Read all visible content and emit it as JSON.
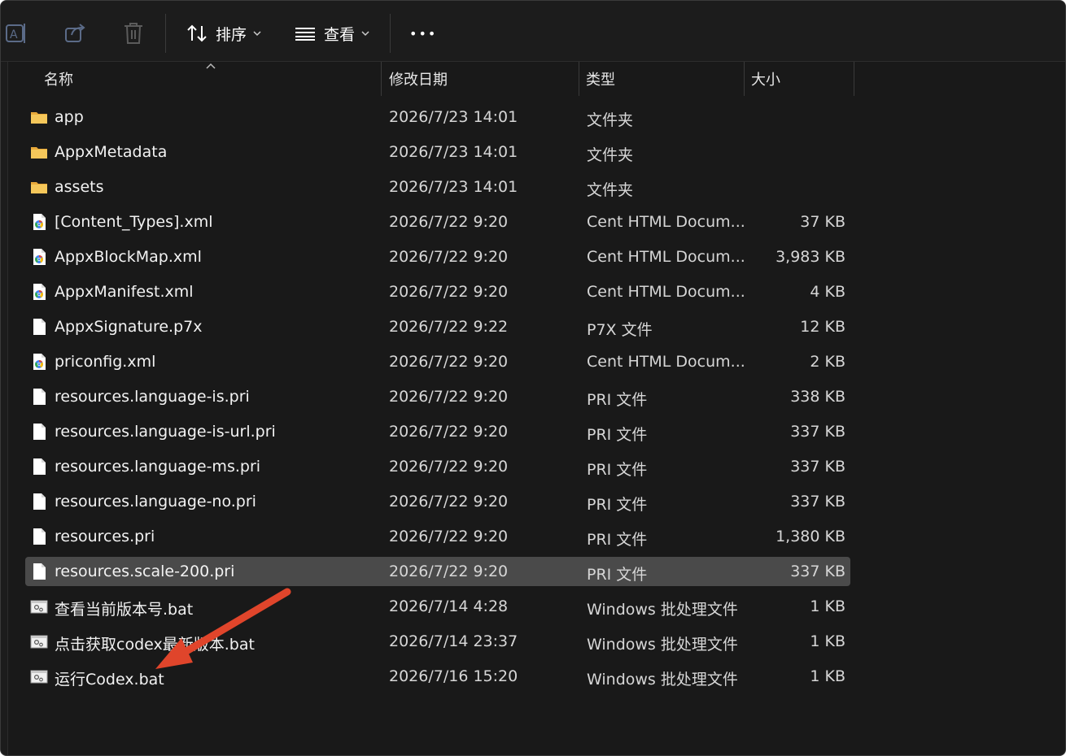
{
  "toolbar": {
    "sort_label": "排序",
    "view_label": "查看",
    "more_label": "•••"
  },
  "columns": {
    "name": "名称",
    "date": "修改日期",
    "type": "类型",
    "size": "大小"
  },
  "colors": {
    "background": "#191919",
    "selected_row": "#4a4a4a",
    "folder": "#f2c14e",
    "annotation_arrow": "#e0452b"
  },
  "files": [
    {
      "icon": "folder-icon",
      "name": "app",
      "date": "2026/7/23 14:01",
      "type": "文件夹",
      "size": ""
    },
    {
      "icon": "folder-icon",
      "name": "AppxMetadata",
      "date": "2026/7/23 14:01",
      "type": "文件夹",
      "size": ""
    },
    {
      "icon": "folder-icon",
      "name": "assets",
      "date": "2026/7/23 14:01",
      "type": "文件夹",
      "size": ""
    },
    {
      "icon": "html-doc-icon",
      "name": "[Content_Types].xml",
      "date": "2026/7/22 9:20",
      "type": "Cent HTML Docum...",
      "size": "37 KB"
    },
    {
      "icon": "html-doc-icon",
      "name": "AppxBlockMap.xml",
      "date": "2026/7/22 9:20",
      "type": "Cent HTML Docum...",
      "size": "3,983 KB"
    },
    {
      "icon": "html-doc-icon",
      "name": "AppxManifest.xml",
      "date": "2026/7/22 9:20",
      "type": "Cent HTML Docum...",
      "size": "4 KB"
    },
    {
      "icon": "file-icon",
      "name": "AppxSignature.p7x",
      "date": "2026/7/22 9:22",
      "type": "P7X 文件",
      "size": "12 KB"
    },
    {
      "icon": "html-doc-icon",
      "name": "priconfig.xml",
      "date": "2026/7/22 9:20",
      "type": "Cent HTML Docum...",
      "size": "2 KB"
    },
    {
      "icon": "file-icon",
      "name": "resources.language-is.pri",
      "date": "2026/7/22 9:20",
      "type": "PRI 文件",
      "size": "338 KB"
    },
    {
      "icon": "file-icon",
      "name": "resources.language-is-url.pri",
      "date": "2026/7/22 9:20",
      "type": "PRI 文件",
      "size": "337 KB"
    },
    {
      "icon": "file-icon",
      "name": "resources.language-ms.pri",
      "date": "2026/7/22 9:20",
      "type": "PRI 文件",
      "size": "337 KB"
    },
    {
      "icon": "file-icon",
      "name": "resources.language-no.pri",
      "date": "2026/7/22 9:20",
      "type": "PRI 文件",
      "size": "337 KB"
    },
    {
      "icon": "file-icon",
      "name": "resources.pri",
      "date": "2026/7/22 9:20",
      "type": "PRI 文件",
      "size": "1,380 KB"
    },
    {
      "icon": "file-icon",
      "name": "resources.scale-200.pri",
      "date": "2026/7/22 9:20",
      "type": "PRI 文件",
      "size": "337 KB",
      "selected": true
    },
    {
      "icon": "bat-file-icon",
      "name": "查看当前版本号.bat",
      "date": "2026/7/14 4:28",
      "type": "Windows 批处理文件",
      "size": "1 KB"
    },
    {
      "icon": "bat-file-icon",
      "name": "点击获取codex最新版本.bat",
      "date": "2026/7/14 23:37",
      "type": "Windows 批处理文件",
      "size": "1 KB"
    },
    {
      "icon": "bat-file-icon",
      "name": "运行Codex.bat",
      "date": "2026/7/16 15:20",
      "type": "Windows 批处理文件",
      "size": "1 KB"
    }
  ]
}
